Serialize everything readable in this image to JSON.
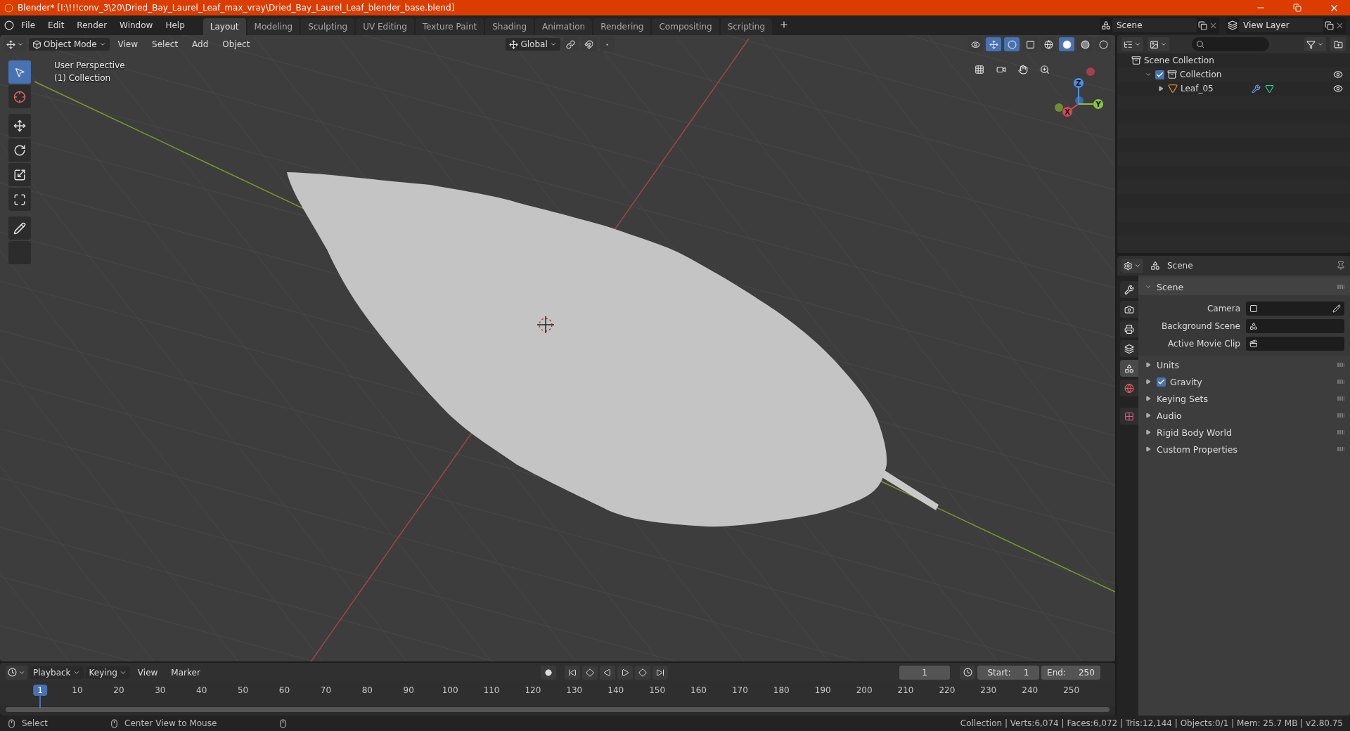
{
  "window": {
    "title": "Blender* [I:\\!!!conv_3\\20\\Dried_Bay_Laurel_Leaf_max_vray\\Dried_Bay_Laurel_Leaf_blender_base.blend]"
  },
  "menu": [
    "File",
    "Edit",
    "Render",
    "Window",
    "Help"
  ],
  "workspaces": [
    {
      "label": "Layout",
      "selected": true
    },
    {
      "label": "Modeling",
      "selected": false
    },
    {
      "label": "Sculpting",
      "selected": false
    },
    {
      "label": "UV Editing",
      "selected": false
    },
    {
      "label": "Texture Paint",
      "selected": false
    },
    {
      "label": "Shading",
      "selected": false
    },
    {
      "label": "Animation",
      "selected": false
    },
    {
      "label": "Rendering",
      "selected": false
    },
    {
      "label": "Compositing",
      "selected": false
    },
    {
      "label": "Scripting",
      "selected": false
    }
  ],
  "scene_selector": {
    "value": "Scene"
  },
  "view_layer_selector": {
    "value": "View Layer"
  },
  "viewport": {
    "mode": "Object Mode",
    "menus": [
      "View",
      "Select",
      "Add",
      "Object"
    ],
    "orientation": "Global",
    "overlay_lines": [
      "User Perspective",
      "(1) Collection"
    ],
    "gizmo_axes": [
      "X",
      "Y",
      "Z"
    ],
    "tools": [
      {
        "kind": "select",
        "selected": true
      },
      {
        "kind": "cursor",
        "selected": false
      },
      {
        "kind": "move",
        "selected": false
      },
      {
        "kind": "rotate",
        "selected": false
      },
      {
        "kind": "scale",
        "selected": false
      },
      {
        "kind": "transform",
        "selected": false
      },
      {
        "kind": "annotate",
        "selected": false
      },
      {
        "kind": "measure",
        "selected": false
      }
    ],
    "shading_modes": [
      {
        "kind": "wireframe",
        "selected": false
      },
      {
        "kind": "solid",
        "selected": true
      },
      {
        "kind": "material",
        "selected": false
      },
      {
        "kind": "rendered",
        "selected": false
      }
    ]
  },
  "outliner": {
    "items": [
      {
        "label": "Scene Collection",
        "kind": "scene_collection",
        "children": [
          {
            "label": "Collection",
            "kind": "collection",
            "checked": true,
            "expanded": true,
            "children": [
              {
                "label": "Leaf_05",
                "kind": "mesh",
                "expanded": false
              }
            ]
          }
        ]
      }
    ]
  },
  "properties": {
    "header": "Scene",
    "tabs": [
      {
        "kind": "tool",
        "selected": false
      },
      {
        "kind": "render",
        "selected": false
      },
      {
        "kind": "output",
        "selected": false
      },
      {
        "kind": "view_layer",
        "selected": false
      },
      {
        "kind": "scene",
        "selected": true
      },
      {
        "kind": "world",
        "selected": false
      },
      {
        "kind": "texture",
        "selected": false
      }
    ],
    "panels": [
      {
        "title": "Scene",
        "expanded": true,
        "fields": [
          {
            "label": "Camera",
            "kind": "camera"
          },
          {
            "label": "Background Scene",
            "kind": "scene"
          },
          {
            "label": "Active Movie Clip",
            "kind": "clip"
          }
        ]
      },
      {
        "title": "Units",
        "expanded": false
      },
      {
        "title": "Gravity",
        "expanded": false,
        "checked": true
      },
      {
        "title": "Keying Sets",
        "expanded": false
      },
      {
        "title": "Audio",
        "expanded": false
      },
      {
        "title": "Rigid Body World",
        "expanded": false
      },
      {
        "title": "Custom Properties",
        "expanded": false
      }
    ]
  },
  "timeline": {
    "dropdowns": [
      "Playback",
      "Keying"
    ],
    "menus": [
      "View",
      "Marker"
    ],
    "current_frame": "1",
    "start_label": "Start:",
    "start": "1",
    "end_label": "End:",
    "end": "250",
    "ticks": [
      {
        "label": "1",
        "selected": true
      },
      {
        "label": "10",
        "selected": false
      },
      {
        "label": "20",
        "selected": false
      },
      {
        "label": "30",
        "selected": false
      },
      {
        "label": "40",
        "selected": false
      },
      {
        "label": "50",
        "selected": false
      },
      {
        "label": "60",
        "selected": false
      },
      {
        "label": "70",
        "selected": false
      },
      {
        "label": "80",
        "selected": false
      },
      {
        "label": "90",
        "selected": false
      },
      {
        "label": "100",
        "selected": false
      },
      {
        "label": "110",
        "selected": false
      },
      {
        "label": "120",
        "selected": false
      },
      {
        "label": "130",
        "selected": false
      },
      {
        "label": "140",
        "selected": false
      },
      {
        "label": "150",
        "selected": false
      },
      {
        "label": "160",
        "selected": false
      },
      {
        "label": "170",
        "selected": false
      },
      {
        "label": "180",
        "selected": false
      },
      {
        "label": "190",
        "selected": false
      },
      {
        "label": "200",
        "selected": false
      },
      {
        "label": "210",
        "selected": false
      },
      {
        "label": "220",
        "selected": false
      },
      {
        "label": "230",
        "selected": false
      },
      {
        "label": "240",
        "selected": false
      },
      {
        "label": "250",
        "selected": false
      }
    ]
  },
  "status": {
    "hints": [
      "Select",
      "Center View to Mouse"
    ],
    "stats": "Collection | Verts:6,074 | Faces:6,072 | Tris:12,144 | Objects:0/1 | Mem: 25.7 MB | v2.80.75"
  }
}
